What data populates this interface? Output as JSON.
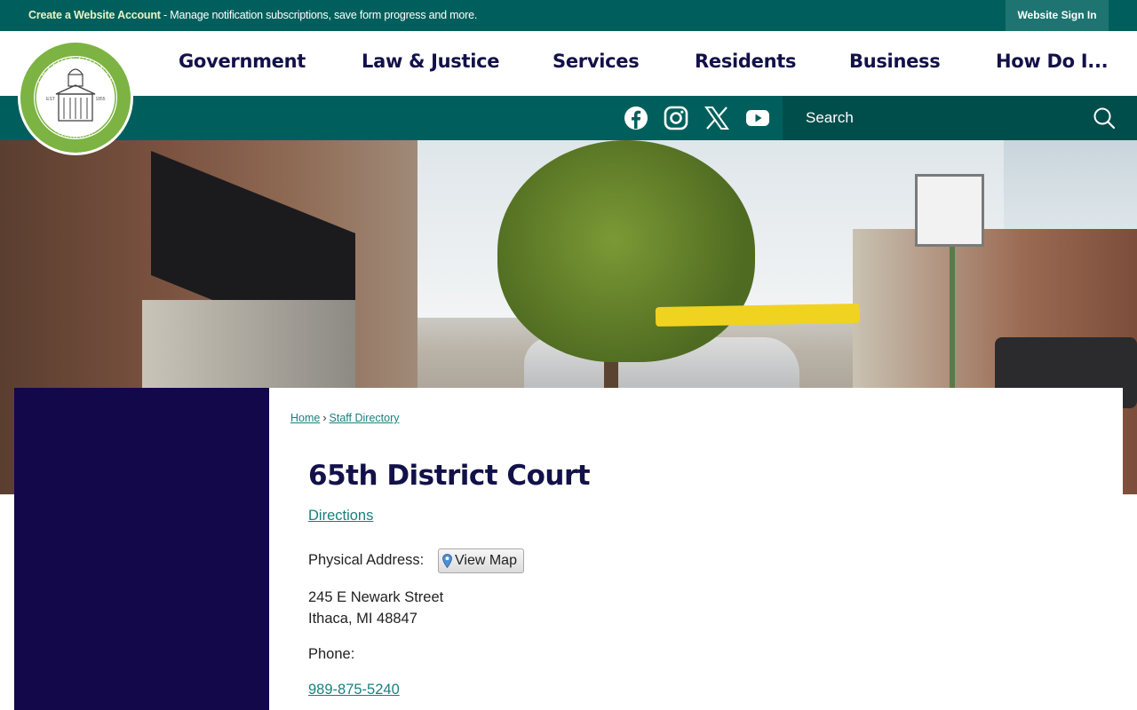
{
  "topbar": {
    "account_link": "Create a Website Account",
    "message": " - Manage notification subscriptions, save form progress and more.",
    "signin_label": "Website Sign In"
  },
  "logo": {
    "name": "GRATIOT COUNTY",
    "state": "MICHIGAN",
    "est_left": "EST",
    "est_right": "1855"
  },
  "nav": {
    "items": [
      "Government",
      "Law & Justice",
      "Services",
      "Residents",
      "Business",
      "How Do I..."
    ]
  },
  "social": {
    "icons": [
      "facebook-icon",
      "instagram-icon",
      "x-twitter-icon",
      "youtube-icon"
    ]
  },
  "search": {
    "placeholder": "Search"
  },
  "breadcrumb": {
    "home": "Home",
    "separator": "›",
    "current": "Staff Directory"
  },
  "main": {
    "title": "65th District Court",
    "directions_label": "Directions",
    "physical_address_label": "Physical Address:",
    "view_map_label": "View Map",
    "address_line1": "245 E Newark Street",
    "address_line2": "Ithaca, MI 48847",
    "phone_label": "Phone:",
    "phone_number": "989-875-5240"
  },
  "colors": {
    "teal_dark": "#005f5c",
    "navy": "#13084a",
    "link": "#1b7f7d",
    "logo_green": "#7cb342"
  }
}
